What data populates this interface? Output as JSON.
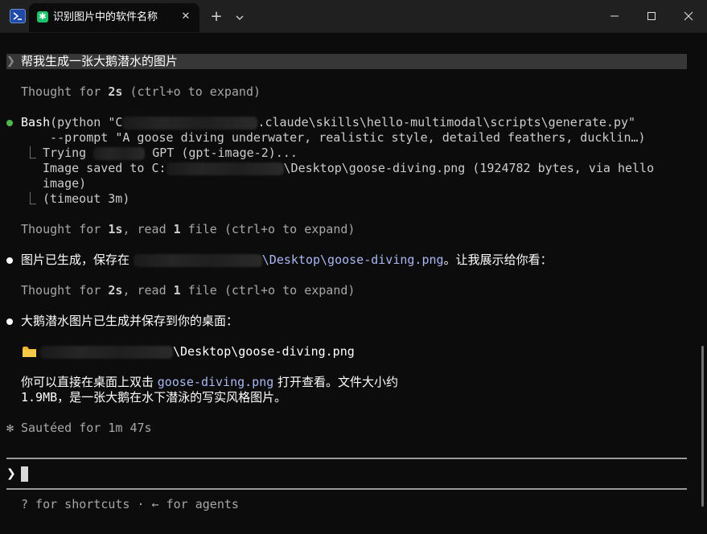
{
  "window": {
    "tab_title": "识别图片中的软件名称",
    "tab_icon": "asterisk-icon",
    "controls": [
      "minimize-icon",
      "maximize-icon",
      "close-icon"
    ]
  },
  "prompt": {
    "caret": "❯",
    "text": "帮我生成一张大鹅潜水的图片"
  },
  "thought1": {
    "prefix": "Thought for ",
    "duration": "2s",
    "suffix": " (ctrl+o to expand)"
  },
  "bash": {
    "tool": "Bash",
    "cmd_start": "(python \"C",
    "cmd_path_end": ".claude\\skills\\hello-multimodal\\scripts\\generate.py\"",
    "cmd_line2": "  --prompt \"A goose diving underwater, realistic style, detailed feathers, ducklin…)",
    "out_branch": "⎿",
    "out_trying_prefix": "Trying ",
    "out_trying_suffix": " GPT (gpt-image-2)...",
    "out_saved_prefix": "Image saved to C:",
    "out_saved_suffix": "\\Desktop\\goose-diving.png (1924782 bytes, via hello",
    "out_saved_wrap": "image)",
    "out_timeout": "(timeout 3m)"
  },
  "thought2": {
    "prefix": "Thought for ",
    "duration": "1s",
    "mid": ", read ",
    "count": "1",
    "suffix": " file (ctrl+o to expand)"
  },
  "msg1": {
    "before": "图片已生成，保存在 ",
    "path": "\\Desktop\\goose-diving.png",
    "after": "。让我展示给你看："
  },
  "thought3": {
    "prefix": "Thought for ",
    "duration": "2s",
    "mid": ", read ",
    "count": "1",
    "suffix": " file (ctrl+o to expand)"
  },
  "msg2": {
    "text": "大鹅潜水图片已生成并保存到你的桌面："
  },
  "file_line": {
    "icon": "folder-icon",
    "path": "\\Desktop\\goose-diving.png"
  },
  "msg3": {
    "line1_before": "你可以直接在桌面上双击 ",
    "line1_file": "goose-diving.png",
    "line1_after": " 打开查看。文件大小约",
    "line2": "1.9MB，是一张大鹅在水下潜泳的写实风格图片。"
  },
  "status": {
    "spinner": "✻",
    "text": "Sautéed for 1m 47s"
  },
  "input": {
    "caret": "❯",
    "value": ""
  },
  "footer": {
    "hint": "? for shortcuts · ← for agents"
  },
  "colors": {
    "background": "#0c0c0c",
    "success_bullet": "#4fb848",
    "path_highlight": "#a8b8f0",
    "tab_icon": "#1ec26a"
  }
}
